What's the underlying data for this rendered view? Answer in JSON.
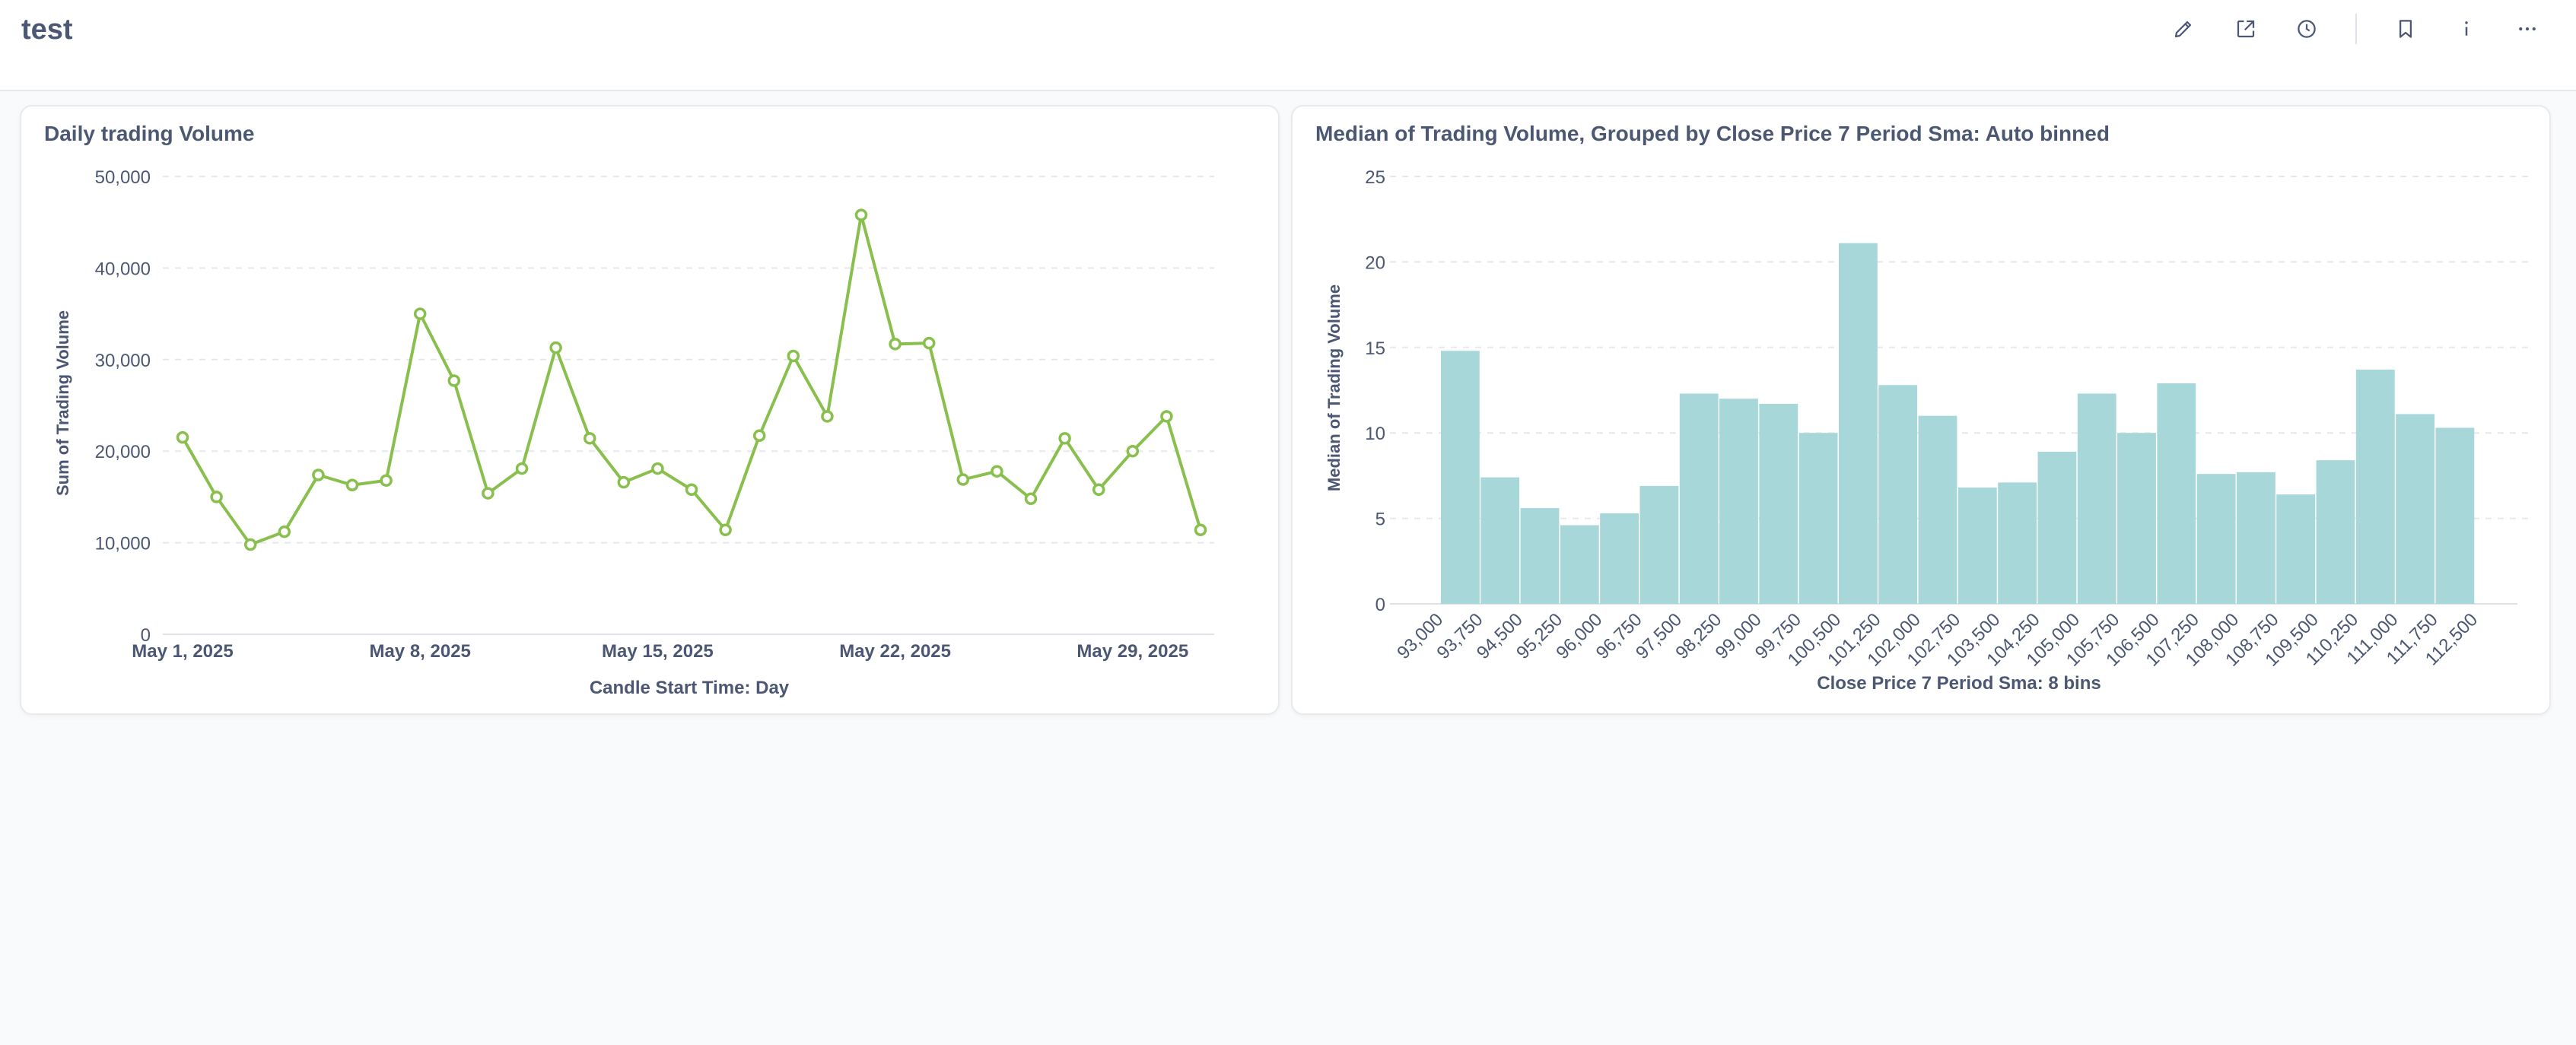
{
  "dashboard": {
    "title": "test"
  },
  "toolbar": {
    "buttons": [
      {
        "name": "edit-button",
        "icon": "pencil-icon"
      },
      {
        "name": "share-button",
        "icon": "share-icon"
      },
      {
        "name": "history-button",
        "icon": "clock-icon"
      },
      {
        "name": "bookmark-button",
        "icon": "bookmark-icon"
      },
      {
        "name": "info-button",
        "icon": "info-icon"
      },
      {
        "name": "more-button",
        "icon": "more-icon"
      }
    ]
  },
  "colors": {
    "line": "#88bf4d",
    "bar": "#a7d7d8",
    "text": "#4c5773",
    "grid": "#e6e8ec"
  },
  "cards": {
    "left": {
      "title": "Daily trading Volume"
    },
    "right": {
      "title": "Median of Trading Volume, Grouped by Close Price 7 Period Sma: Auto binned"
    }
  },
  "chart_data": [
    {
      "type": "line",
      "title": "Daily trading Volume",
      "xlabel": "Candle Start Time: Day",
      "ylabel": "Sum of Trading Volume",
      "x_tick_labels": [
        "May 1, 2025",
        "May 8, 2025",
        "May 15, 2025",
        "May 22, 2025",
        "May 29, 2025"
      ],
      "x_tick_days": [
        1,
        8,
        15,
        22,
        29
      ],
      "y_ticks": [
        "0",
        "10,000",
        "20,000",
        "30,000",
        "40,000",
        "50,000"
      ],
      "ylim": [
        0,
        50000
      ],
      "xlim": [
        1,
        31
      ],
      "grid": true,
      "series": [
        {
          "x": [
            1,
            2,
            3,
            4,
            5,
            6,
            7,
            8,
            9,
            10,
            11,
            12,
            13,
            14,
            15,
            16,
            17,
            18,
            19,
            20,
            21,
            22,
            23,
            24,
            25,
            26,
            27,
            28,
            29,
            30,
            31
          ],
          "values": [
            21500,
            15000,
            9800,
            11200,
            17400,
            16300,
            16800,
            35000,
            27700,
            15400,
            18100,
            31300,
            21400,
            16600,
            18100,
            15800,
            11400,
            21700,
            30400,
            23800,
            45800,
            31700,
            31800,
            16900,
            17800,
            14800,
            21400,
            15800,
            20000,
            23800,
            11400
          ]
        }
      ]
    },
    {
      "type": "bar",
      "title": "Median of Trading Volume, Grouped by Close Price 7 Period Sma: Auto binned",
      "xlabel": "Close Price 7 Period Sma: 8 bins",
      "ylabel": "Median of Trading Volume",
      "y_ticks": [
        "0",
        "5",
        "10",
        "15",
        "20",
        "25"
      ],
      "ylim": [
        0,
        25
      ],
      "grid": true,
      "categories": [
        "93,000",
        "93,750",
        "94,500",
        "95,250",
        "96,000",
        "96,750",
        "97,500",
        "98,250",
        "99,000",
        "99,750",
        "100,500",
        "101,250",
        "102,000",
        "102,750",
        "103,500",
        "104,250",
        "105,000",
        "105,750",
        "106,500",
        "107,250",
        "108,000",
        "108,750",
        "109,500",
        "110,250",
        "111,000",
        "111,750",
        "112,500"
      ],
      "values": [
        14.8,
        7.4,
        5.6,
        4.6,
        5.3,
        6.9,
        12.3,
        12.0,
        11.7,
        10.0,
        21.1,
        12.8,
        11.0,
        6.8,
        7.1,
        8.9,
        12.3,
        10.0,
        12.9,
        7.6,
        7.7,
        6.4,
        8.4,
        13.7,
        11.1,
        10.3
      ]
    }
  ]
}
